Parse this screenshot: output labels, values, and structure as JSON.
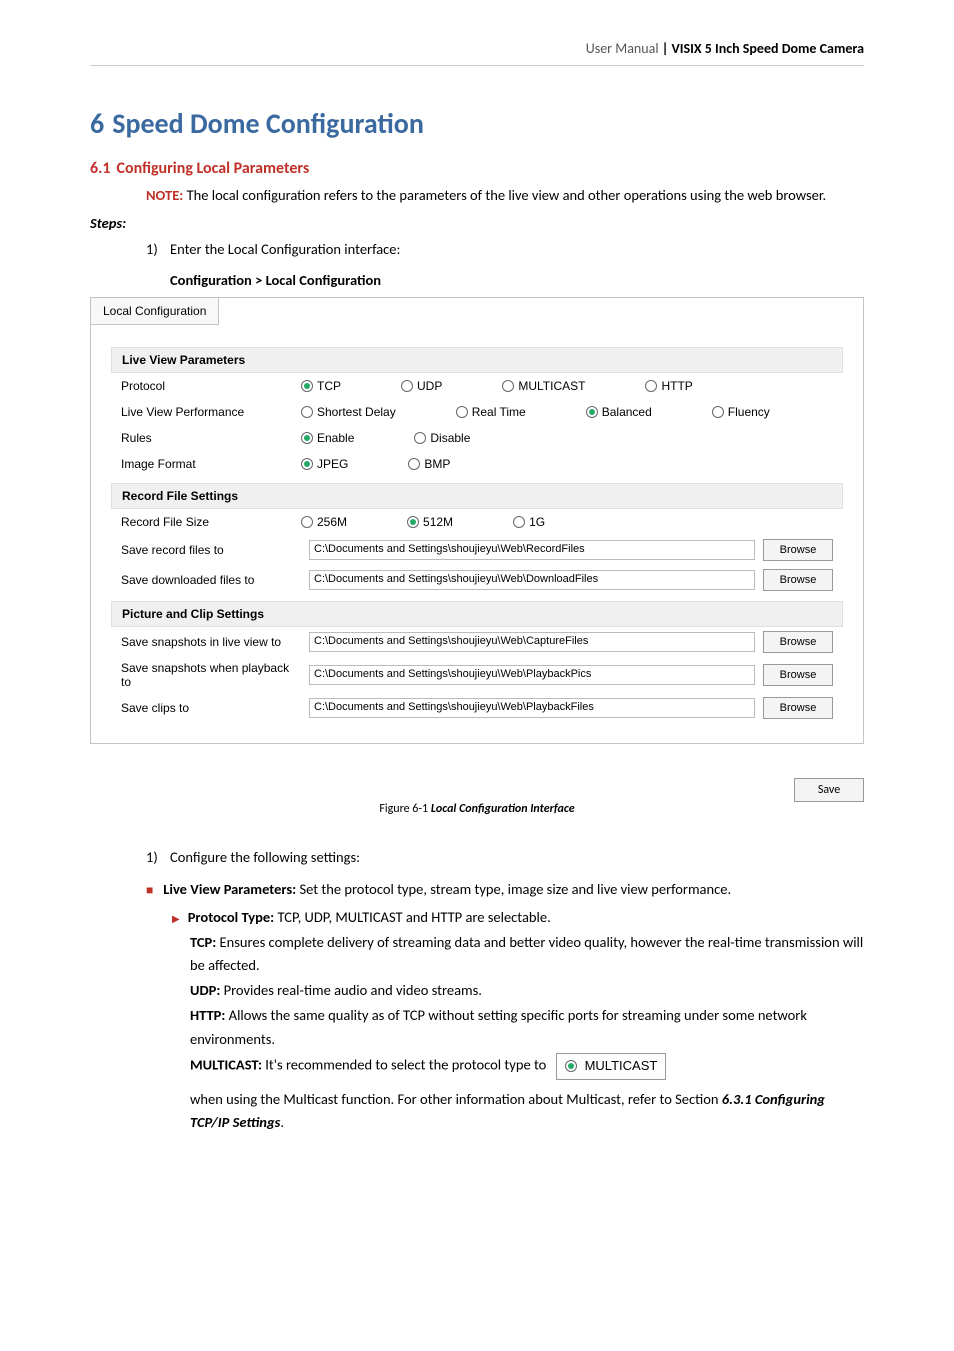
{
  "header": {
    "manual": "User Manual",
    "product": " | VISIX 5 Inch Speed Dome Camera"
  },
  "chapter": {
    "num": "6",
    "title": "Speed Dome Configuration"
  },
  "section": {
    "num": "6.1",
    "title": "Configuring Local Parameters"
  },
  "note": {
    "label": "NOTE:",
    "text": " The local configuration refers to the parameters of the live view and other operations using the web browser."
  },
  "steps_label": "Steps:",
  "step1": {
    "idx": "1)",
    "text": "Enter the Local Configuration interface:"
  },
  "breadcrumb": "Configuration > Local Configuration",
  "panel": {
    "tab": "Local Configuration",
    "sec1": "Live View Parameters",
    "protocol": {
      "label": "Protocol",
      "tcp": "TCP",
      "udp": "UDP",
      "multicast": "MULTICAST",
      "http": "HTTP"
    },
    "perf": {
      "label": "Live View Performance",
      "shortest": "Shortest Delay",
      "realtime": "Real Time",
      "balanced": "Balanced",
      "fluency": "Fluency"
    },
    "rules": {
      "label": "Rules",
      "enable": "Enable",
      "disable": "Disable"
    },
    "imgfmt": {
      "label": "Image Format",
      "jpeg": "JPEG",
      "bmp": "BMP"
    },
    "sec2": "Record File Settings",
    "rfs": {
      "label": "Record File Size",
      "s256": "256M",
      "s512": "512M",
      "s1g": "1G"
    },
    "save_record": {
      "label": "Save record files to",
      "path": "C:\\Documents and Settings\\shoujieyu\\Web\\RecordFiles"
    },
    "save_download": {
      "label": "Save downloaded files to",
      "path": "C:\\Documents and Settings\\shoujieyu\\Web\\DownloadFiles"
    },
    "sec3": "Picture and Clip Settings",
    "snap_live": {
      "label": "Save snapshots in live view to",
      "path": "C:\\Documents and Settings\\shoujieyu\\Web\\CaptureFiles"
    },
    "snap_playback": {
      "label": "Save snapshots when playback to",
      "path": "C:\\Documents and Settings\\shoujieyu\\Web\\PlaybackPics"
    },
    "save_clips": {
      "label": "Save clips to",
      "path": "C:\\Documents and Settings\\shoujieyu\\Web\\PlaybackFiles"
    },
    "browse": "Browse",
    "save": "Save"
  },
  "figure": {
    "fig": "Figure 6-1 ",
    "title": "Local Configuration Interface"
  },
  "step2": {
    "idx": "1)",
    "text": "Configure the following settings:"
  },
  "lv_params": {
    "label": "Live View Parameters:",
    "text": " Set the protocol type, stream type, image size and live view performance."
  },
  "ptype": {
    "label": "Protocol Type:",
    "text": " TCP, UDP, MULTICAST and HTTP are selectable."
  },
  "tcp": {
    "label": "TCP:",
    "text": " Ensures complete delivery of streaming data and better video quality, however the real-time transmission will be affected."
  },
  "udp": {
    "label": "UDP:",
    "text": " Provides real-time audio and video streams."
  },
  "http": {
    "label": "HTTP:",
    "text": " Allows the same quality as of TCP without setting specific ports for streaming under some network environments."
  },
  "multicast": {
    "label": "MULTICAST:",
    "pre": " It's recommended to select the protocol type to ",
    "radio_label": "MULTICAST",
    "post": "when using the Multicast function. For other information about Multicast, refer to Section ",
    "ref": "6.3.1 Configuring TCP/IP Settings",
    "dot": "."
  }
}
